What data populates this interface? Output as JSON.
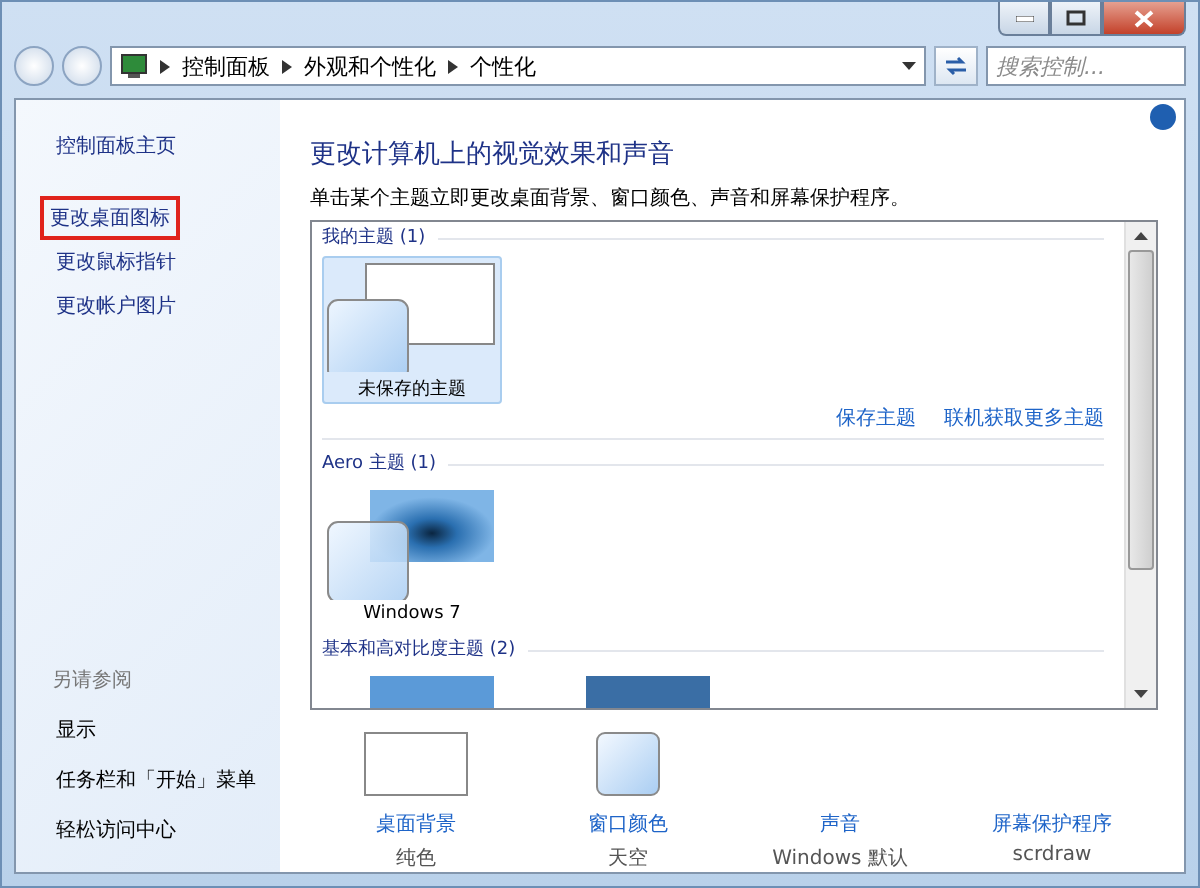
{
  "address_bar": {
    "breadcrumbs": [
      "控制面板",
      "外观和个性化",
      "个性化"
    ],
    "search": {
      "placeholder": "搜索控制..."
    }
  },
  "sidebar": {
    "home": "控制面板主页",
    "tasks": [
      {
        "label": "更改桌面图标",
        "highlighted": true
      },
      {
        "label": "更改鼠标指针",
        "highlighted": false
      },
      {
        "label": "更改帐户图片",
        "highlighted": false
      }
    ],
    "see_also": {
      "title": "另请参阅",
      "links": [
        "显示",
        "任务栏和「开始」菜单",
        "轻松访问中心"
      ]
    }
  },
  "main": {
    "heading": "更改计算机上的视觉效果和声音",
    "description": "单击某个主题立即更改桌面背景、窗口颜色、声音和屏幕保护程序。",
    "groups": [
      {
        "title": "我的主题 (1)",
        "themes": [
          {
            "kind": "unsaved",
            "name": "未保存的主题",
            "selected": true
          }
        ],
        "links": [
          "保存主题",
          "联机获取更多主题"
        ]
      },
      {
        "title": "Aero 主题 (1)",
        "themes": [
          {
            "kind": "aero",
            "name": "Windows 7",
            "selected": false
          }
        ]
      },
      {
        "title": "基本和高对比度主题 (2)",
        "themes": [
          {
            "kind": "basic",
            "selected": false
          },
          {
            "kind": "classic",
            "selected": false
          }
        ]
      }
    ],
    "settings": [
      {
        "kind": "background",
        "label": "桌面背景",
        "value": "纯色"
      },
      {
        "kind": "color",
        "label": "窗口颜色",
        "value": "天空"
      },
      {
        "kind": "sound",
        "label": "声音",
        "value": "Windows 默认"
      },
      {
        "kind": "screensaver",
        "label": "屏幕保护程序",
        "value": "scrdraw"
      }
    ]
  }
}
